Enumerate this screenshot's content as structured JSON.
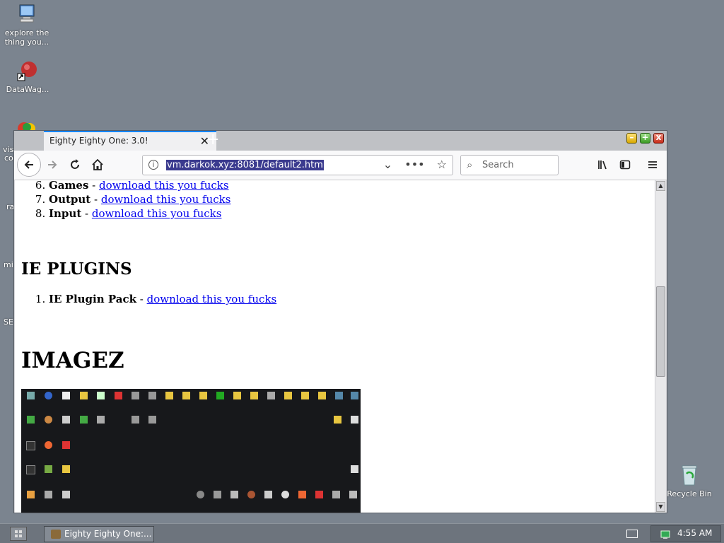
{
  "desktop": {
    "icons": [
      {
        "label": "explore the thing you...",
        "icon": "network-computer-icon"
      },
      {
        "label": "DataWag...",
        "icon": "datawag-icon"
      },
      {
        "label": "Recycle Bin",
        "icon": "recycle-bin-icon"
      }
    ],
    "partial_labels": [
      "vis",
      "co",
      "ra",
      "mi",
      "SE"
    ]
  },
  "browser": {
    "tab_title": "Eighty Eighty One: 3.0!",
    "tab_close": "✕",
    "new_tab": "+",
    "url": "vm.darkok.xyz:8081/default2.htm",
    "search_placeholder": "Search",
    "window_controls": {
      "minimize": "–",
      "maximize": "+",
      "close": "x"
    }
  },
  "page": {
    "list1": [
      {
        "num": "6.",
        "name": "Games",
        "sep": " - ",
        "link": "download this you fucks"
      },
      {
        "num": "7.",
        "name": "Output",
        "sep": " - ",
        "link": "download this you fucks"
      },
      {
        "num": "8.",
        "name": "Input",
        "sep": " - ",
        "link": "download this you fucks"
      }
    ],
    "ie_heading": "IE PLUGINS",
    "ie_list": [
      {
        "num": "1.",
        "name": "IE Plugin Pack",
        "sep": " - ",
        "link": "download this you fucks"
      }
    ],
    "imagez_heading": "IMAGEZ"
  },
  "taskbar": {
    "task_label": "Eighty Eighty One:...",
    "clock": "4:55 AM"
  },
  "colors": {
    "desktop_bg": "#7b848f",
    "link": "#0000ee",
    "url_highlight": "#3b3b8f"
  }
}
